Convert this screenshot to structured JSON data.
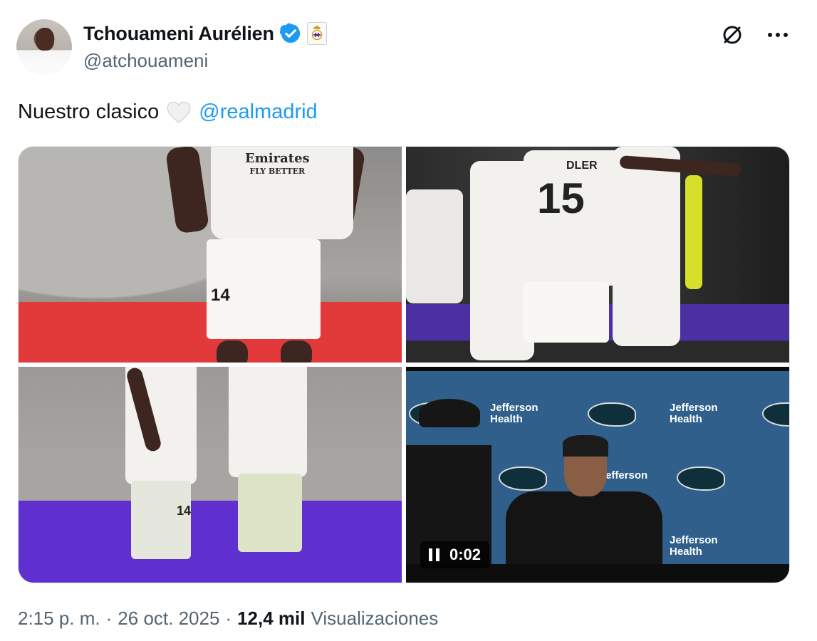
{
  "author": {
    "display_name": "Tchouameni Aurélien",
    "handle": "@atchouameni",
    "verified_color": "#1d9bf0"
  },
  "tweet": {
    "text": "Nuestro clasico",
    "mention": "@realmadrid",
    "emoji": "white-heart"
  },
  "media": [
    {
      "kind": "photo",
      "jersey_number": "14",
      "sponsor_line1": "Emirates",
      "sponsor_line2": "FLY BETTER"
    },
    {
      "kind": "photo",
      "jersey_number": "15",
      "name_fragment": "DLER"
    },
    {
      "kind": "photo",
      "jersey_number": "14"
    },
    {
      "kind": "video",
      "timer": "0:02",
      "sponsor_line1": "Jefferson",
      "sponsor_line2": "Health",
      "extra": "efferson"
    }
  ],
  "meta": {
    "time": "2:15 p. m.",
    "sep1": "·",
    "date": "26 oct. 2025",
    "sep2": "·",
    "views_count": "12,4 mil",
    "views_label": "Visualizaciones"
  },
  "icons": {
    "grok": "grok-icon",
    "more": "more-options-icon"
  }
}
